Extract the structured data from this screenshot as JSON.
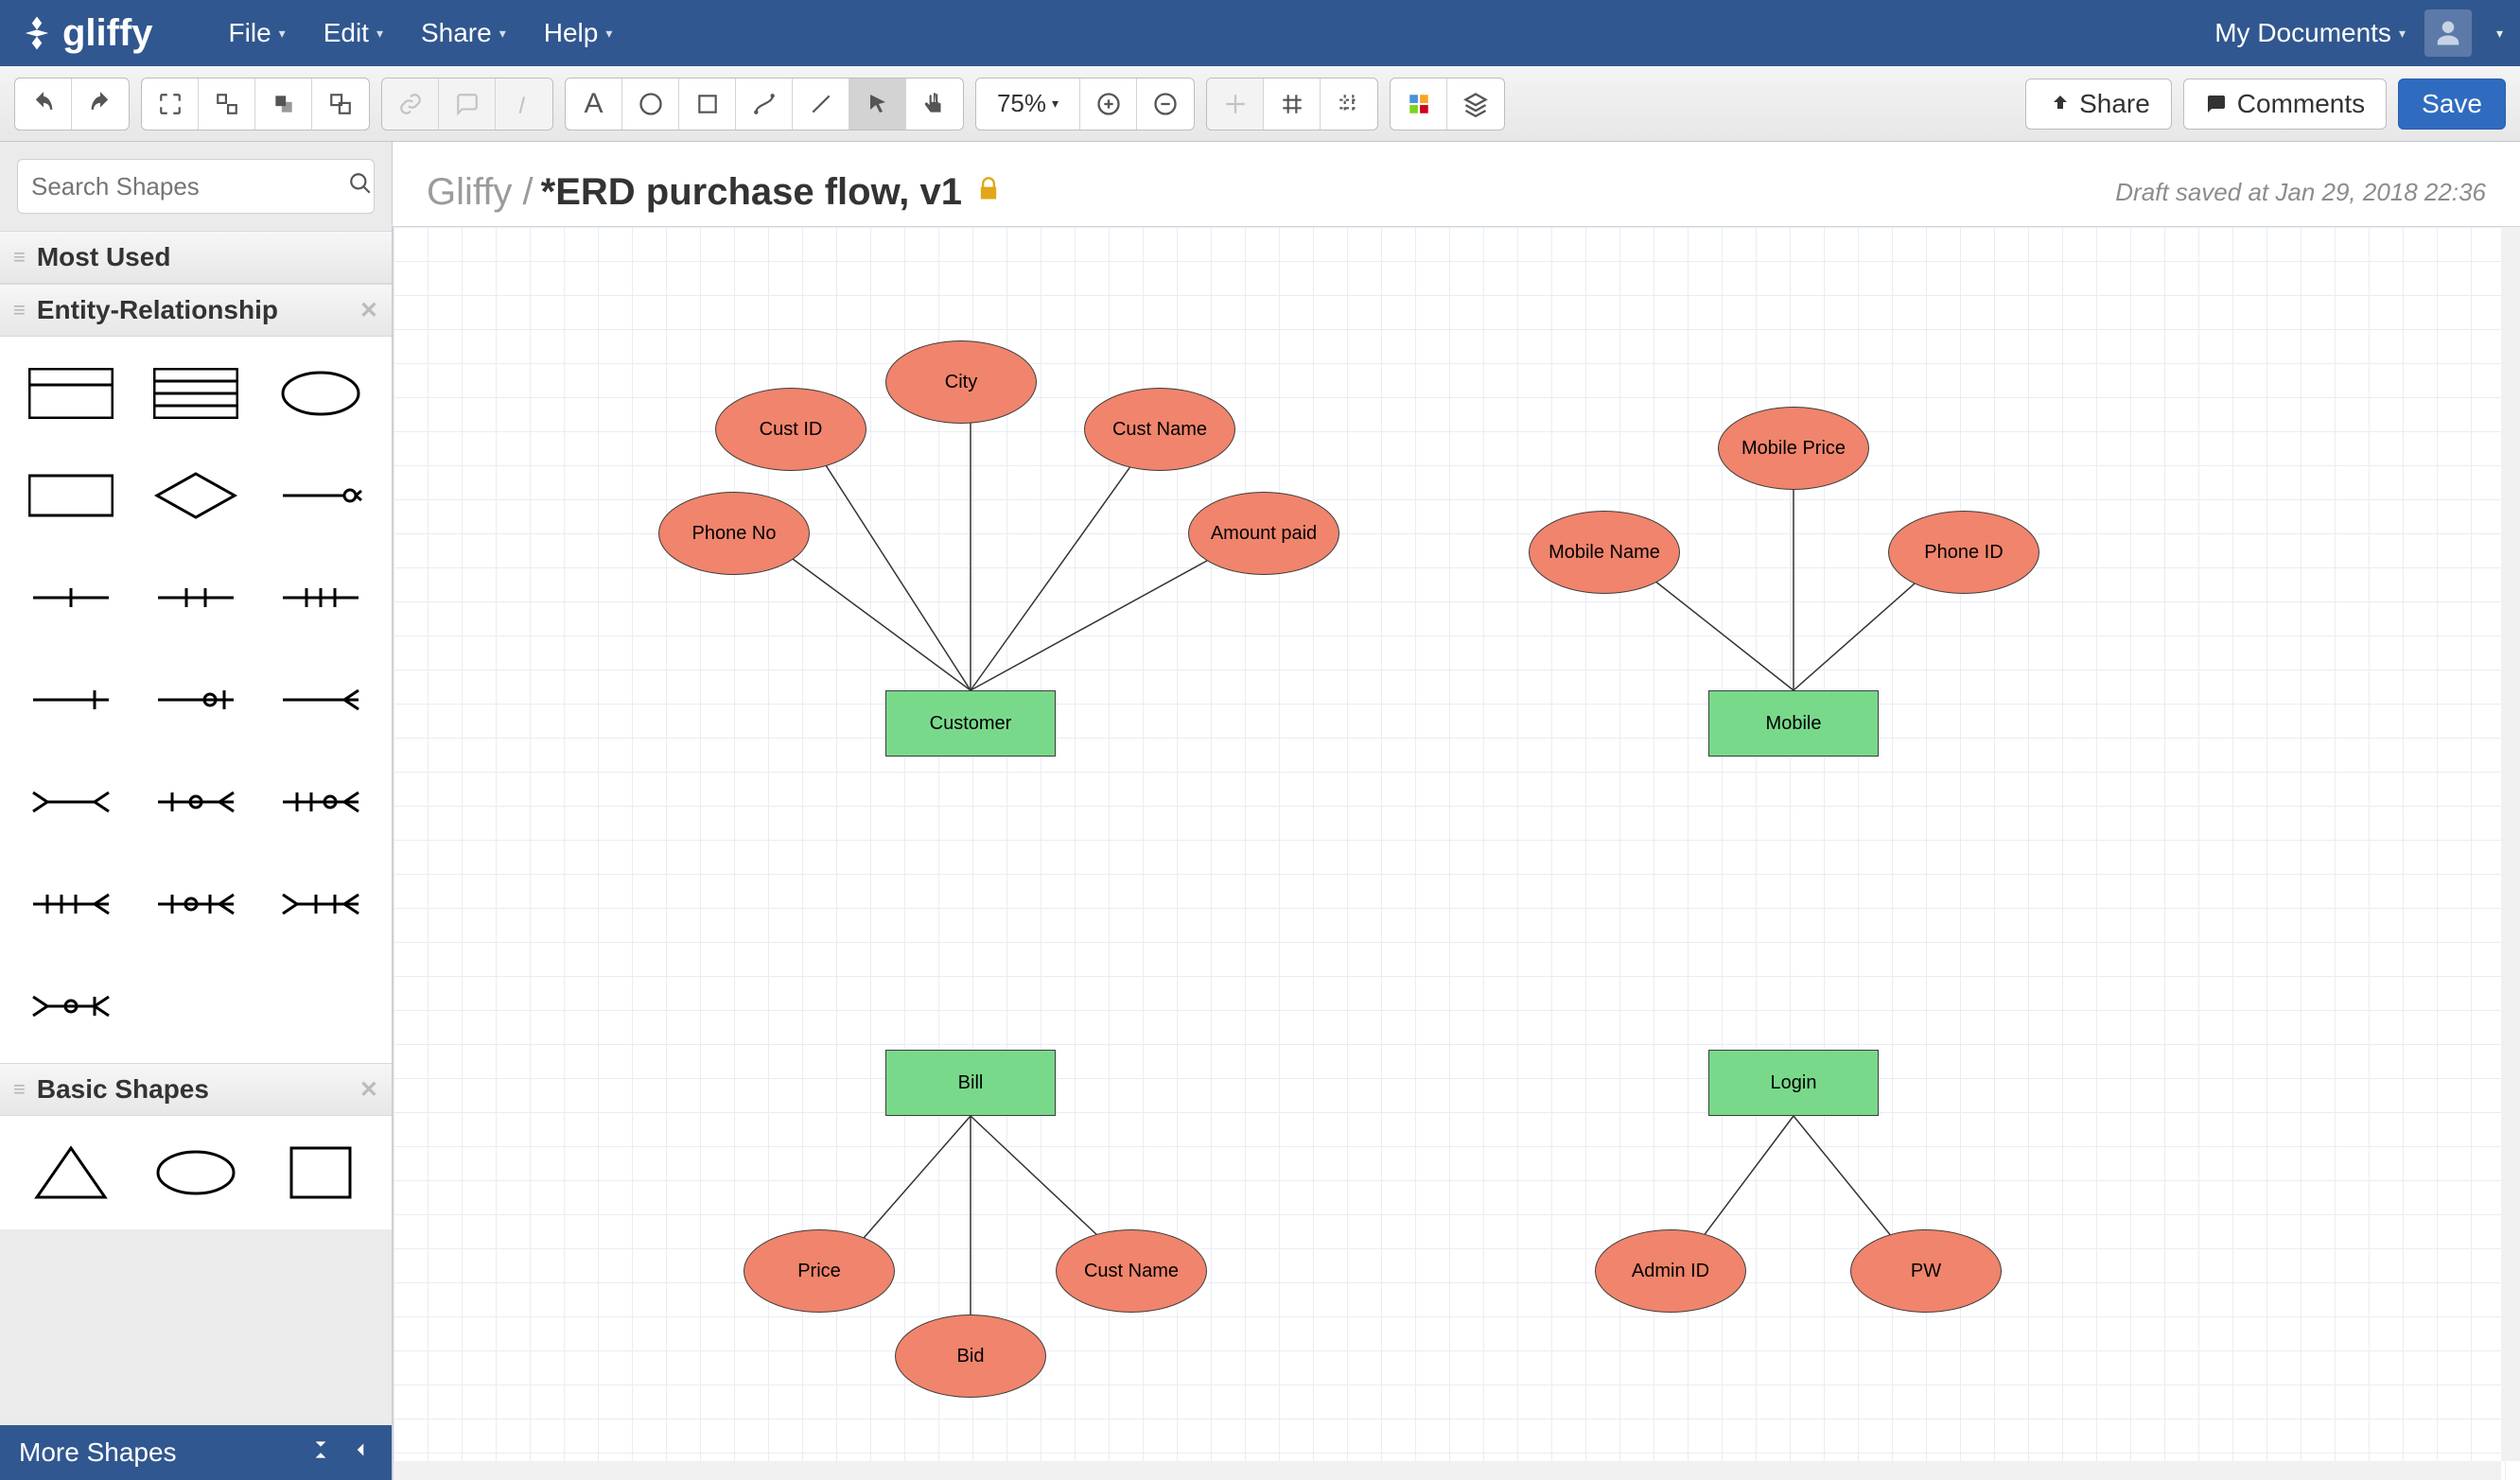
{
  "menubar": {
    "logo": "gliffy",
    "items": [
      "File",
      "Edit",
      "Share",
      "Help"
    ],
    "right_link": "My Documents"
  },
  "toolbar": {
    "zoom": "75%",
    "share": "Share",
    "comments": "Comments",
    "save": "Save"
  },
  "sidebar": {
    "search_placeholder": "Search Shapes",
    "sections": {
      "most_used": "Most Used",
      "er": "Entity-Relationship",
      "basic": "Basic Shapes"
    },
    "footer": "More Shapes"
  },
  "document": {
    "crumb": "Gliffy /",
    "title": "*ERD purchase flow, v1",
    "status": "Draft saved at Jan 29, 2018 22:36"
  },
  "diagram": {
    "entities": {
      "customer": "Customer",
      "mobile": "Mobile",
      "bill": "Bill",
      "login": "Login"
    },
    "attrs": {
      "phone_no": "Phone No",
      "cust_id": "Cust ID",
      "city": "City",
      "cust_name": "Cust Name",
      "amount_paid": "Amount paid",
      "mobile_name": "Mobile Name",
      "mobile_price": "Mobile Price",
      "phone_id": "Phone ID",
      "price": "Price",
      "bid": "Bid",
      "cust_name2": "Cust Name",
      "admin_id": "Admin ID",
      "pw": "PW"
    }
  }
}
